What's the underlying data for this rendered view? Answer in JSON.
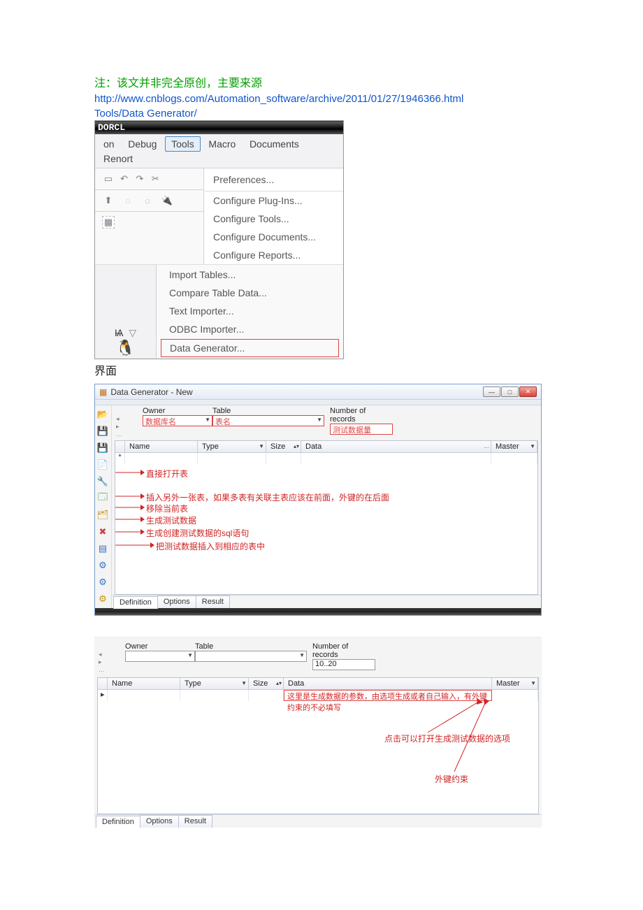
{
  "intro": {
    "note": "注：该文并非完全原创，主要来源",
    "url": "http://www.cnblogs.com/Automation_software/archive/2011/01/27/1946366.html",
    "path": "Tools/Data Generator/"
  },
  "ss1": {
    "titlebar": "DORCL",
    "menu": {
      "on": "on",
      "debug": "Debug",
      "tools": "Tools",
      "macro": "Macro",
      "documents": "Documents",
      "report": "Renort"
    },
    "dropdown": {
      "preferences": "Preferences...",
      "configure_plugins": "Configure Plug-Ins...",
      "configure_tools": "Configure Tools...",
      "configure_documents": "Configure Documents...",
      "configure_reports": "Configure Reports..."
    },
    "lower": {
      "import_tables": "Import Tables...",
      "compare_table_data": "Compare Table Data...",
      "text_importer": "Text Importer...",
      "odbc_importer": "ODBC Importer...",
      "data_generator": "Data Generator..."
    }
  },
  "zh_interface": "界面",
  "ss2": {
    "window_title": "Data Generator - New",
    "labels": {
      "owner": "Owner",
      "table": "Table",
      "num_records": "Number of records",
      "name": "Name",
      "type": "Type",
      "size": "Size",
      "data": "Data",
      "master": "Master"
    },
    "hints": {
      "owner_hint": "数据库名",
      "table_hint": "表名",
      "num_records_hint": "测试数据量"
    },
    "annotations": {
      "a1": "直接打开表",
      "a2": "插入另外一张表，如果多表有关联主表应该在前面，外键的在后面",
      "a3": "移除当前表",
      "a4": "生成测试数据",
      "a5": "生成创建测试数据的sql语句",
      "a6": "把测试数据插入到相应的表中"
    },
    "tabs": {
      "definition": "Definition",
      "options": "Options",
      "result": "Result"
    }
  },
  "ss3": {
    "labels": {
      "owner": "Owner",
      "table": "Table",
      "num_records": "Number of records",
      "name": "Name",
      "type": "Type",
      "size": "Size",
      "data": "Data",
      "master": "Master"
    },
    "values": {
      "num_records": "10..20"
    },
    "row_data_hint": "这里是生成数据的参数，由选项生成或者自己输入，有外键约束的不必填写",
    "annotations": {
      "open_options": "点击可以打开生成测试数据的选项",
      "fk": "外键约束"
    },
    "tabs": {
      "definition": "Definition",
      "options": "Options",
      "result": "Result"
    }
  }
}
